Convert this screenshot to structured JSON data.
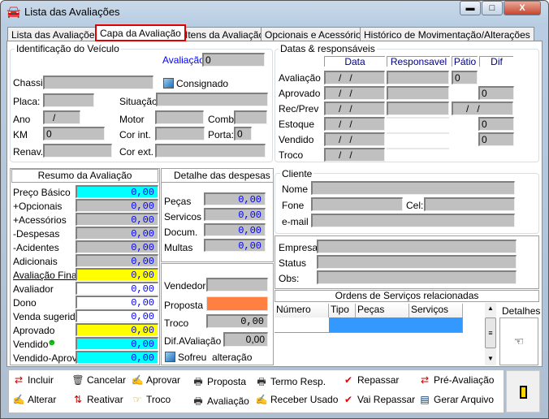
{
  "window": {
    "title": "Lista das Avaliações",
    "minimize": "▬",
    "maximize": "□",
    "close": "X"
  },
  "tabs": [
    "Lista das Avaliações",
    "Capa da Avaliação",
    "Itens da Avaliação",
    "Opcionais e Acessórios",
    "Histórico de Movimentação/Alterações"
  ],
  "active_tab": "Capa da Avaliação",
  "vehicle": {
    "group": "Identificação do Veículo",
    "avaliacao_label": "Avaliação",
    "avaliacao": "0",
    "chassi": "Chassi",
    "consignado": "Consignado",
    "placa": "Placa:",
    "situacao": "Situação",
    "ano": "Ano",
    "ano_value": "/",
    "motor": "Motor",
    "comb": "Comb.",
    "km": "KM",
    "km_value": "0",
    "cor_int": "Cor int.",
    "porta": "Porta:",
    "porta_value": "0",
    "renav": "Renav.",
    "cor_ext": "Cor ext."
  },
  "resumo": {
    "title": "Resumo da Avaliação",
    "rows": [
      {
        "label": "Preço Básico",
        "value": "0,00"
      },
      {
        "label": "+Opcionais",
        "value": "0,00"
      },
      {
        "label": "+Acessórios",
        "value": "0,00"
      },
      {
        "label": "-Despesas",
        "value": "0,00"
      },
      {
        "label": "-Acidentes",
        "value": "0,00"
      },
      {
        "label": "Adicionais",
        "value": "0,00"
      },
      {
        "label": "Avaliação Final",
        "value": "0,00"
      },
      {
        "label": "Avaliador",
        "value": "0,00"
      },
      {
        "label": "Dono",
        "value": "0,00"
      },
      {
        "label": "Venda sugerida",
        "value": "0,00"
      },
      {
        "label": "Aprovado",
        "value": "0,00"
      },
      {
        "label": "Vendido",
        "value": "0,00"
      },
      {
        "label": "Vendido-Aprov.",
        "value": "0,00"
      }
    ]
  },
  "despesas": {
    "title": "Detalhe das despesas",
    "rows": [
      {
        "label": "Peças",
        "value": "0,00"
      },
      {
        "label": "Servicos",
        "value": "0,00"
      },
      {
        "label": "Docum.",
        "value": "0,00"
      },
      {
        "label": "Multas",
        "value": "0,00"
      }
    ]
  },
  "venda": {
    "vendedor": "Vendedor",
    "proposta": "Proposta",
    "proposta_color": "#ff8040",
    "troco": "Troco",
    "troco_value": "0,00",
    "dif": "Dif.AValiação",
    "dif_value": "0,00",
    "sofreu": "Sofreu  alteração"
  },
  "datas": {
    "group": "Datas & responsáveis",
    "headers": [
      "Data",
      "Responsavel",
      "Pátio",
      "Dif"
    ],
    "rows": [
      {
        "label": "Avaliação",
        "date": "/   /",
        "patio": "0"
      },
      {
        "label": "Aprovado",
        "date": "/   /",
        "dif": "0"
      },
      {
        "label": "Rec/Prev",
        "date": "/   /",
        "patio": "/   /"
      },
      {
        "label": "Estoque",
        "date": "/   /",
        "dif": "0"
      },
      {
        "label": "Vendido",
        "date": "/   /",
        "dif": "0"
      },
      {
        "label": "Troco",
        "date": "/   /"
      }
    ]
  },
  "cliente": {
    "group": "Cliente",
    "nome": "Nome",
    "fone": "Fone",
    "cel": "Cel:",
    "email": "e-mail"
  },
  "empresa": {
    "empresa": "Empresa",
    "status": "Status",
    "obs": "Obs:"
  },
  "ordens": {
    "title": "Ordens de Serviços relacionadas",
    "columns": [
      "Número",
      "Tipo",
      "Peças",
      "Serviços"
    ],
    "detalhes": "Detalhes",
    "selected_color": "#3399ff"
  },
  "toolbar": {
    "row1": [
      "Incluir",
      "Cancelar",
      "Aprovar",
      "Proposta",
      "Termo Resp.",
      "Repassar",
      "Pré-Avaliação"
    ],
    "row2": [
      "Alterar",
      "Reativar",
      "Troco",
      "Avaliação",
      "Receber Usado",
      "Vai Repassar",
      "Gerar Arquivo"
    ]
  }
}
